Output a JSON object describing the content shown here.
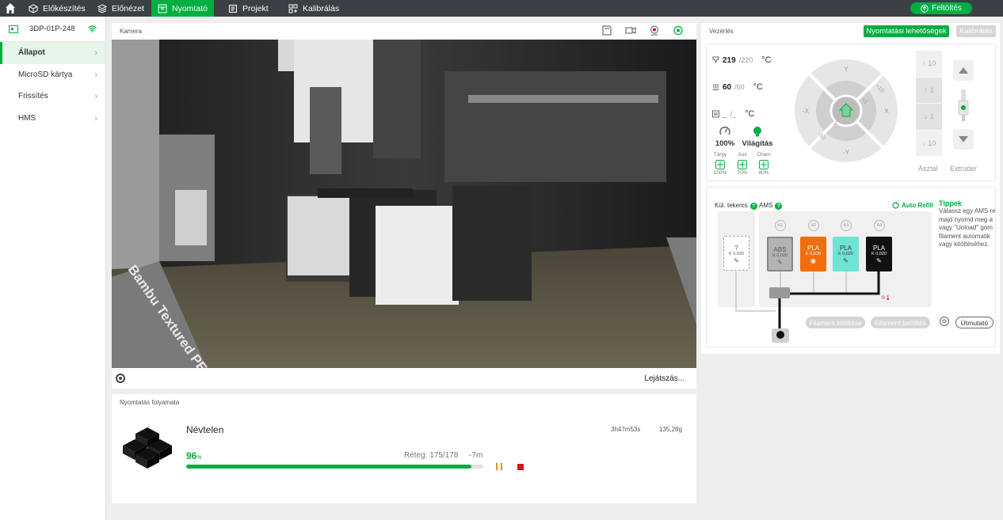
{
  "topbar": {
    "tabs": [
      {
        "label": "Előkészítés",
        "icon": "cube-outline-icon"
      },
      {
        "label": "Előnézet",
        "icon": "layers-icon"
      },
      {
        "label": "Nyomtató",
        "icon": "printer-icon"
      },
      {
        "label": "Projekt",
        "icon": "document-icon"
      },
      {
        "label": "Kalibrálás",
        "icon": "calibration-icon"
      }
    ],
    "active_tab": "Nyomtató",
    "upload_label": "Feltöltés"
  },
  "sidebar": {
    "device_name": "3DP-01P-248",
    "items": [
      {
        "label": "Állapot",
        "active": true
      },
      {
        "label": "MicroSD kártya",
        "active": false
      },
      {
        "label": "Frissítés",
        "active": false
      },
      {
        "label": "HMS",
        "active": false
      }
    ]
  },
  "camera": {
    "title": "Kamera",
    "replay_label": "Lejátszás...",
    "feed_text": "Bambu Textured PEI Plate"
  },
  "progress": {
    "title": "Nyomtatás folyamata",
    "job_name": "Névtelen",
    "time": "3h47m53s",
    "weight": "135,28g",
    "percent": "96",
    "percent_unit": "%",
    "progress_fraction": 0.96,
    "layer": "Réteg: 175/178",
    "remaining": "-7m"
  },
  "control": {
    "title": "Vezérlés",
    "print_options_label": "Nyomtatási lehetőségek",
    "calibration_label": "Kalibrálás",
    "nozzle": {
      "current": "219",
      "target": "/220",
      "unit": "°C"
    },
    "bed": {
      "current": "60",
      "target": "/60",
      "unit": "°C"
    },
    "chamber": {
      "current": "_",
      "target": "/_",
      "unit": "°C"
    },
    "speed": "100%",
    "light_label": "Világítás",
    "fans": [
      {
        "label": "Tárgy",
        "value": "100%"
      },
      {
        "label": "Aux",
        "value": "70%"
      },
      {
        "label": "Cham",
        "value": "80%"
      }
    ],
    "jog": {
      "y": "Y",
      "minus_y": "-Y",
      "x": "X",
      "minus_x": "-X",
      "p10": "+10",
      "p1": "+1",
      "m1": "-1",
      "m10": "-10"
    },
    "z_buttons": [
      "10",
      "1",
      "1",
      "10"
    ],
    "table_label": "Asztal",
    "extruder_label": "Extruder"
  },
  "ams": {
    "ext_spool_label": "Kül. tekercs",
    "ams_label": "AMS",
    "auto_refill_label": "Auto Refill",
    "ext_spool": {
      "type": "?",
      "k": "K 0,020"
    },
    "slots": [
      {
        "id": "A1",
        "type": "ABS",
        "k": "K 0,020",
        "color": "#b3b3b3",
        "text_color": "#555555",
        "icon": "pencil-icon"
      },
      {
        "id": "A2",
        "type": "PLA",
        "k": "K 0,020",
        "color": "#f26d0d",
        "text_color": "#ffffff",
        "icon": "eye-icon"
      },
      {
        "id": "A3",
        "type": "PLA",
        "k": "K 0,020",
        "color": "#6fe3d4",
        "text_color": "#333333",
        "icon": "pencil-icon"
      },
      {
        "id": "A4",
        "type": "PLA",
        "k": "K 0,020",
        "color": "#111111",
        "text_color": "#ffffff",
        "icon": "pencil-icon"
      }
    ],
    "humidity_label": "0",
    "load_btn": "Filament kitöltése",
    "unload_btn": "Filament betöltés",
    "guide_btn": "Útmutató",
    "tips_title": "Tippek",
    "tips_text": "Válassz egy AMS re\nmajd nyomd meg a\nvagy \"Unload\" gom\nfilament automatik\nvagy kitöltéséhez."
  },
  "colors": {
    "accent": "#00ae42",
    "topbar_bg": "#3b4045",
    "stop": "#d01818",
    "pause": "#f08a00"
  }
}
